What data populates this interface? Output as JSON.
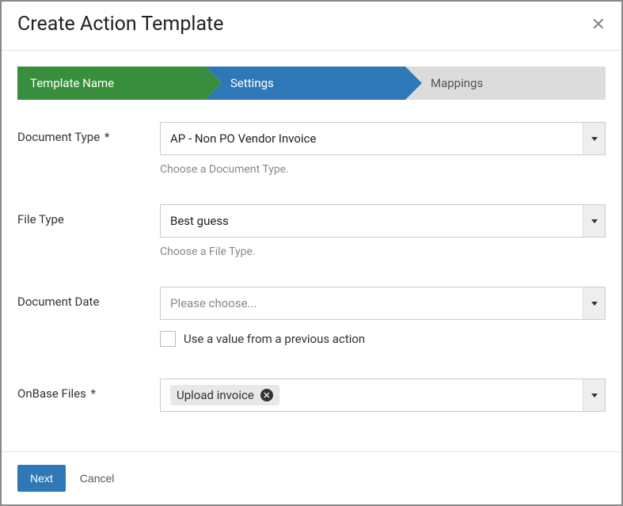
{
  "modal": {
    "title": "Create Action Template",
    "steps": [
      {
        "label": "Template Name"
      },
      {
        "label": "Settings"
      },
      {
        "label": "Mappings"
      }
    ]
  },
  "form": {
    "documentType": {
      "label": "Document Type",
      "required": "*",
      "value": "AP - Non PO Vendor Invoice",
      "help": "Choose a Document Type."
    },
    "fileType": {
      "label": "File Type",
      "value": "Best guess",
      "help": "Choose a File Type."
    },
    "documentDate": {
      "label": "Document Date",
      "placeholder": "Please choose...",
      "checkboxLabel": "Use a value from a previous action"
    },
    "onbaseFiles": {
      "label": "OnBase Files",
      "required": "*",
      "chip": "Upload invoice"
    }
  },
  "footer": {
    "next": "Next",
    "cancel": "Cancel"
  }
}
